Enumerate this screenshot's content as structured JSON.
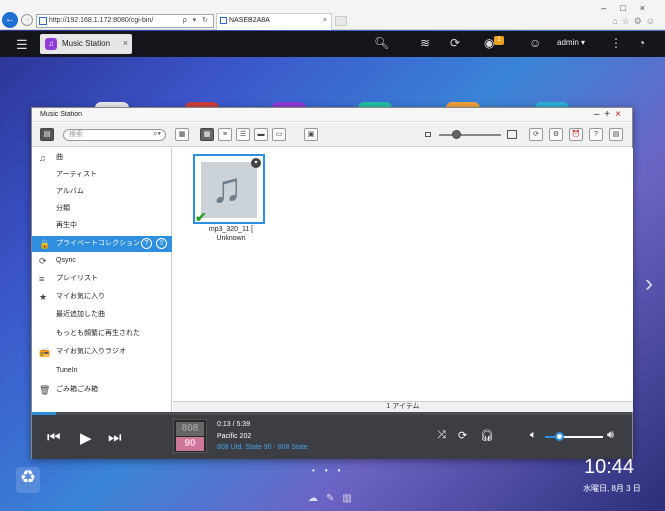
{
  "browser": {
    "address": "http://192.168.1.172:8080/cgi-bin/",
    "address_controls": "ρ ▾ ↻",
    "tab_title": "NASEB2A8A",
    "tab_close": "×"
  },
  "qnap": {
    "app_tab_label": "Music Station",
    "app_tab_close": "×",
    "notification_count": "1",
    "user": "admin ▾"
  },
  "window": {
    "title": "Music Station",
    "search_placeholder": "検索"
  },
  "sidebar": {
    "items": [
      {
        "label": "曲",
        "icon": "♫"
      },
      {
        "label": "アーティスト"
      },
      {
        "label": "アルバム"
      },
      {
        "label": "分類"
      },
      {
        "label": "再生中"
      },
      {
        "label": "プライベートコレクション",
        "icon": "🔒"
      },
      {
        "label": "Qsync",
        "icon": "⟳"
      },
      {
        "label": "プレイリスト",
        "icon": "≡"
      },
      {
        "label": "マイお気に入り",
        "icon": "★"
      },
      {
        "label": "最近追加した曲"
      },
      {
        "label": "もっとも頻繁に再生された"
      },
      {
        "label": "マイお気に入りラジオ",
        "icon": "📻"
      },
      {
        "label": "TuneIn"
      },
      {
        "label": "ごみ箱ごみ箱",
        "icon": "🗑"
      }
    ]
  },
  "content": {
    "album_title": "mp3_320_11 [",
    "album_artist": "Unknown",
    "status": "1 アイテム"
  },
  "player": {
    "progress_fraction": 0.04,
    "volume_fraction": 0.25,
    "time": "0:13 / 5:39",
    "song": "Pacific 202",
    "artist": "808 Utd. State 90 - 808 State",
    "art_top": "808",
    "art_bottom": "90"
  },
  "desktop": {
    "clock": "10:44",
    "date": "水曜日, 8月 3 日"
  },
  "colors": {
    "accent": "#2e8fdf",
    "player_bg": "#3c3e43",
    "topbar_bg": "#15161c"
  }
}
